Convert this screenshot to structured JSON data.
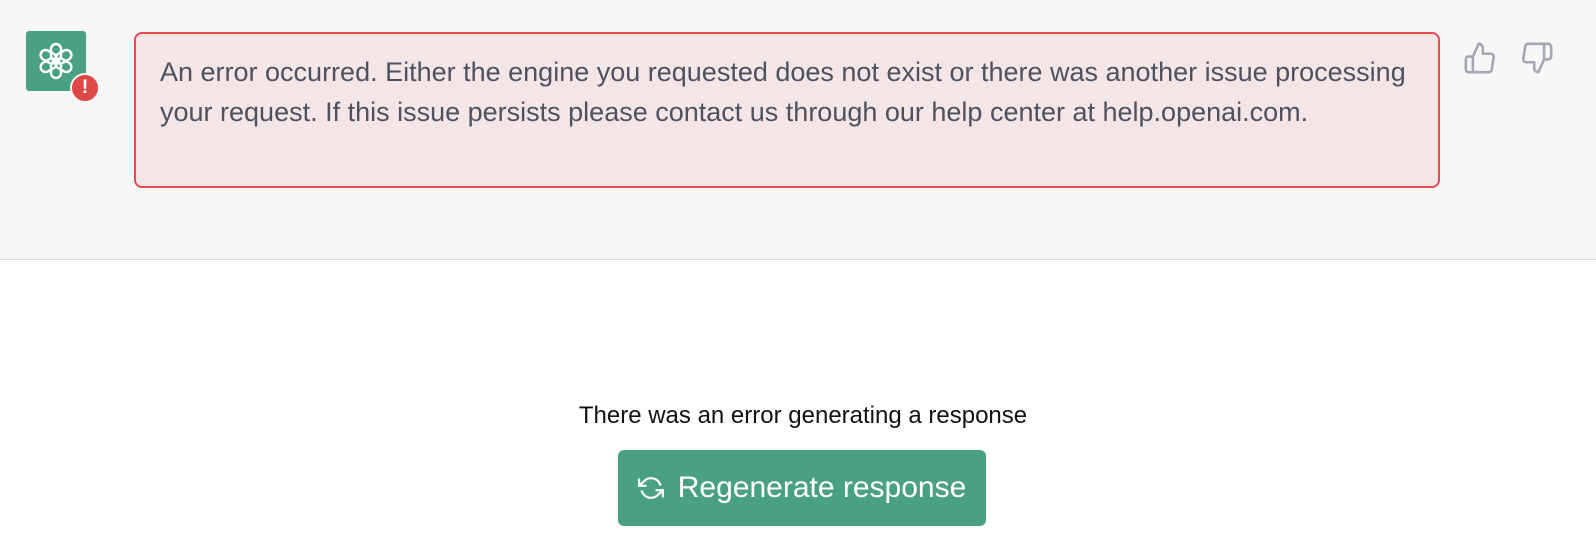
{
  "message": {
    "avatar_icon": "openai-logo-icon",
    "badge_icon": "error-exclamation-icon",
    "badge_text": "!",
    "error_text": "An error occurred. Either the engine you requested does not exist or there was another issue processing your request. If this issue persists please contact us through our help center at help.openai.com.",
    "feedback": {
      "up_icon": "thumbs-up-icon",
      "down_icon": "thumbs-down-icon"
    }
  },
  "footer": {
    "status_text": "There was an error generating a response",
    "regenerate_label": "Regenerate response",
    "regenerate_icon": "refresh-icon"
  },
  "colors": {
    "accent": "#4aa181",
    "error_border": "#e8484f",
    "error_bg": "#f4e5e7",
    "badge": "#e04848"
  }
}
